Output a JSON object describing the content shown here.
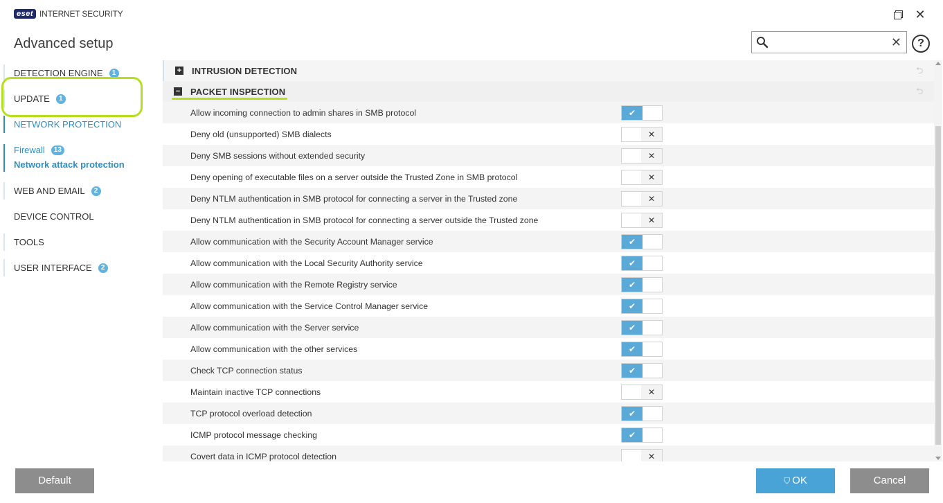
{
  "app": {
    "logo_badge": "eset",
    "product_name": "INTERNET SECURITY"
  },
  "header": {
    "title": "Advanced setup",
    "search": {
      "value": "",
      "placeholder": ""
    },
    "help_label": "?"
  },
  "sidebar": {
    "items": [
      {
        "label": "DETECTION ENGINE",
        "badge": "1"
      },
      {
        "label": "UPDATE",
        "badge": "1"
      },
      {
        "label": "NETWORK PROTECTION",
        "badge": ""
      },
      {
        "label": "WEB AND EMAIL",
        "badge": "2"
      },
      {
        "label": "DEVICE CONTROL",
        "badge": ""
      },
      {
        "label": "TOOLS",
        "badge": ""
      },
      {
        "label": "USER INTERFACE",
        "badge": "2"
      }
    ],
    "sub_items": [
      {
        "label": "Firewall",
        "badge": "13"
      },
      {
        "label": "Network attack protection",
        "badge": ""
      }
    ]
  },
  "sections": {
    "intrusion": {
      "title": "INTRUSION DETECTION",
      "expanded": false
    },
    "packet": {
      "title": "PACKET INSPECTION",
      "expanded": true
    }
  },
  "settings": [
    {
      "label": "Allow incoming connection to admin shares in SMB protocol",
      "enabled": true
    },
    {
      "label": "Deny old (unsupported) SMB dialects",
      "enabled": false
    },
    {
      "label": "Deny SMB sessions without extended security",
      "enabled": false
    },
    {
      "label": "Deny opening of executable files on a server outside the Trusted Zone in SMB protocol",
      "enabled": false
    },
    {
      "label": "Deny NTLM authentication in SMB protocol for connecting a server in the Trusted zone",
      "enabled": false
    },
    {
      "label": "Deny NTLM authentication in SMB protocol for connecting a server outside the Trusted zone",
      "enabled": false
    },
    {
      "label": "Allow communication with the Security Account Manager service",
      "enabled": true
    },
    {
      "label": "Allow communication with the Local Security Authority service",
      "enabled": true
    },
    {
      "label": "Allow communication with the Remote Registry service",
      "enabled": true
    },
    {
      "label": "Allow communication with the Service Control Manager service",
      "enabled": true
    },
    {
      "label": "Allow communication with the Server service",
      "enabled": true
    },
    {
      "label": "Allow communication with the other services",
      "enabled": true
    },
    {
      "label": "Check TCP connection status",
      "enabled": true
    },
    {
      "label": "Maintain inactive TCP connections",
      "enabled": false
    },
    {
      "label": "TCP protocol overload detection",
      "enabled": true
    },
    {
      "label": "ICMP protocol message checking",
      "enabled": true
    },
    {
      "label": "Covert data in ICMP protocol detection",
      "enabled": false
    }
  ],
  "footer": {
    "default_label": "Default",
    "ok_label": "OK",
    "cancel_label": "Cancel"
  },
  "colors": {
    "accent": "#2d8fc1",
    "toggle_on": "#5aa9d6",
    "highlight": "#b5de1f",
    "button_gray": "#8d8d8d",
    "button_ok": "#4aa3d6"
  }
}
